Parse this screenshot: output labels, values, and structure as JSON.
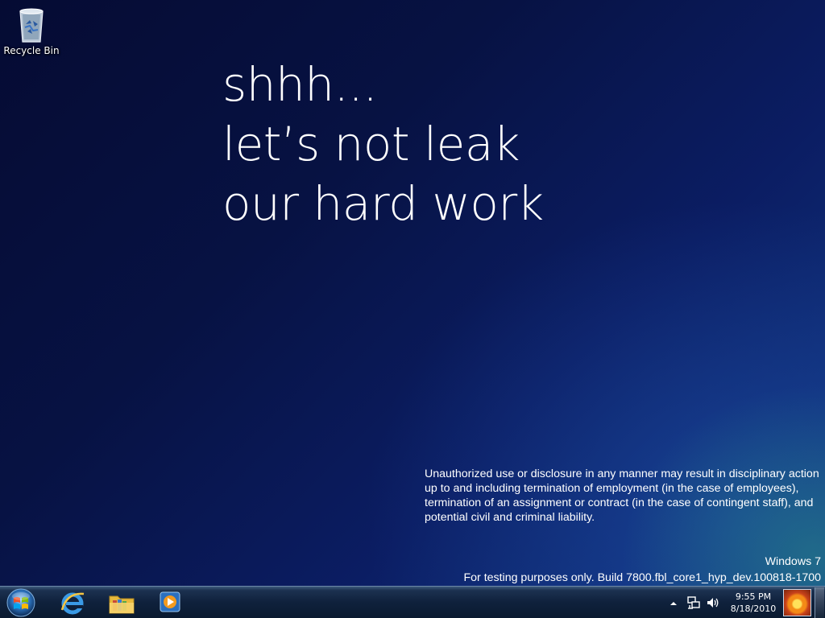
{
  "desktop": {
    "icons": [
      {
        "label": "Recycle Bin",
        "icon": "recycle-bin-icon"
      }
    ]
  },
  "headline": {
    "line1": "shhh...",
    "line2": "let’s not leak",
    "line3": "our hard work"
  },
  "legal": {
    "text": "Unauthorized use or disclosure in any manner may result in disciplinary action up to and including termination of employment (in the case of employees), termination of an assignment or contract (in the case of contingent staff), and potential civil and criminal liability."
  },
  "watermark": {
    "product": "Windows 7",
    "build": "For testing purposes only. Build 7800.fbl_core1_hyp_dev.100818-1700"
  },
  "taskbar": {
    "start_icon": "windows-start-orb-icon",
    "pinned": [
      {
        "name": "internet-explorer",
        "icon": "internet-explorer-icon"
      },
      {
        "name": "windows-explorer",
        "icon": "folder-library-icon"
      },
      {
        "name": "media-player",
        "icon": "media-player-icon"
      }
    ],
    "tray": {
      "icons": [
        "show-hidden-icons-arrow-icon",
        "network-icon",
        "volume-icon"
      ],
      "time": "9:55 PM",
      "date": "8/18/2010"
    }
  },
  "colors": {
    "desktop_top": "#050b33",
    "desktop_bottom_right": "#123a86",
    "accent_teal": "#288c82",
    "taskbar": "#0f213c"
  }
}
